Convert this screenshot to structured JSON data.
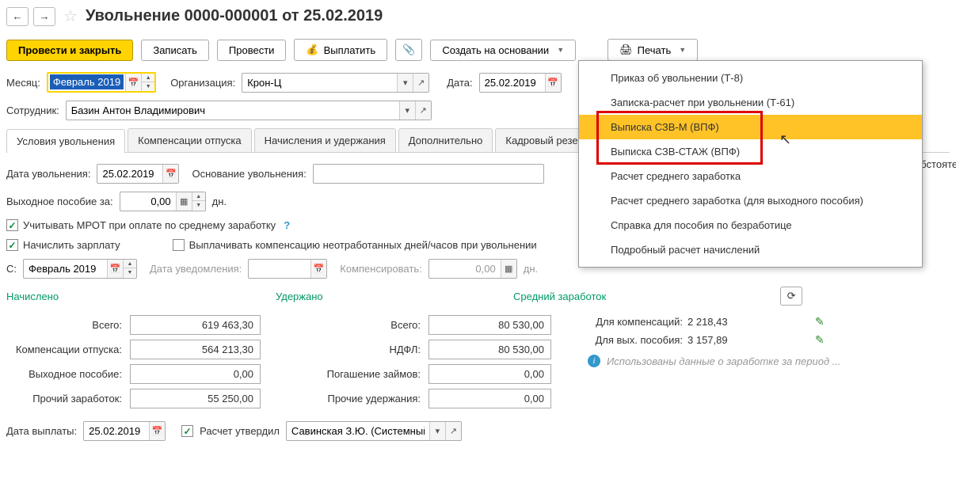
{
  "header": {
    "title": "Увольнение 0000-000001 от 25.02.2019"
  },
  "toolbar": {
    "submit_close": "Провести и закрыть",
    "save": "Записать",
    "submit": "Провести",
    "pay": "Выплатить",
    "create_based": "Создать на основании",
    "print": "Печать"
  },
  "fields": {
    "month_label": "Месяц:",
    "month_value": "Февраль 2019",
    "org_label": "Организация:",
    "org_value": "Крон-Ц",
    "date_label": "Дата:",
    "date_value": "25.02.2019",
    "employee_label": "Сотрудник:",
    "employee_value": "Базин Антон Владимирович",
    "fire_date_label": "Дата увольнения:",
    "fire_date_value": "25.02.2019",
    "basis_label": "Основание увольнения:",
    "basis_value": "",
    "severance_label": "Выходное пособие за:",
    "severance_value": "0,00",
    "severance_unit": "дн.",
    "mrot_label": "Учитывать МРОТ при оплате по среднему заработку",
    "accrue_label": "Начислить зарплату",
    "pay_comp_label": "Выплачивать компенсацию неотработанных дней/часов при увольнении",
    "from_label": "С:",
    "from_value": "Февраль 2019",
    "notice_date_label": "Дата уведомления:",
    "notice_date_value": "",
    "compensate_label": "Компенсировать:",
    "compensate_value": "0,00",
    "compensate_unit": "дн.",
    "payment_date_label": "Дата выплаты:",
    "payment_date_value": "25.02.2019",
    "approved_label": "Расчет утвердил",
    "approved_value": "Савинская З.Ю. (Системный п",
    "truncated": "обстоятел"
  },
  "tabs": [
    "Условия увольнения",
    "Компенсации отпуска",
    "Начисления и удержания",
    "Дополнительно",
    "Кадровый резерв"
  ],
  "totals": {
    "accrued_title": "Начислено",
    "withheld_title": "Удержано",
    "avg_title": "Средний заработок",
    "rows": {
      "total_lbl": "Всего:",
      "total_accrued": "619 463,30",
      "total_withheld": "80 530,00",
      "comp_lbl": "Компенсации отпуска:",
      "comp_val": "564 213,30",
      "ndfl_lbl": "НДФЛ:",
      "ndfl_val": "80 530,00",
      "severance_lbl": "Выходное пособие:",
      "severance_val": "0,00",
      "loan_lbl": "Погашение займов:",
      "loan_val": "0,00",
      "other_income_lbl": "Прочий заработок:",
      "other_income_val": "55 250,00",
      "other_withhold_lbl": "Прочие удержания:",
      "other_withhold_val": "0,00",
      "for_comp_lbl": "Для компенсаций:",
      "for_comp_val": "2 218,43",
      "for_sev_lbl": "Для вых. пособия:",
      "for_sev_val": "3 157,89",
      "info_text": "Использованы данные о заработке за период ..."
    }
  },
  "print_menu": {
    "items": [
      "Приказ об увольнении (Т-8)",
      "Записка-расчет при увольнении (Т-61)",
      "Выписка СЗВ-М (ВПФ)",
      "Выписка СЗВ-СТАЖ (ВПФ)",
      "Расчет среднего заработка",
      "Расчет среднего заработка (для выходного пособия)",
      "Справка для пособия по безработице",
      "Подробный расчет начислений"
    ]
  }
}
